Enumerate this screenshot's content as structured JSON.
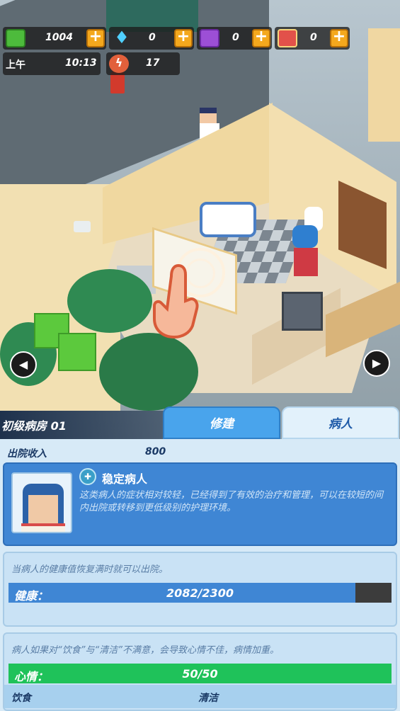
{
  "hud": {
    "cash": "1004",
    "gems": "0",
    "books": "0",
    "cards": "0",
    "period": "上午",
    "time": "10:13",
    "energy": "17"
  },
  "room": {
    "name": "初级病房 01",
    "tabs": [
      "修建",
      "病人"
    ]
  },
  "panel": {
    "income_label": "出院收入",
    "income_value": "800",
    "status": {
      "title": "稳定病人",
      "description": "这类病人的症状相对较轻，已经得到了有效的治疗和管理，可以在较短的间内出院或转移到更低级别的护理环境。"
    },
    "health": {
      "hint": "当病人的健康值恢复满时就可以出院。",
      "label": "健康：",
      "value": "2082/2300",
      "current": 2082,
      "max": 2300
    },
    "mood": {
      "hint": "病人如果对“饮食”与“清洁”不满意，会导致心情不佳，病情加重。",
      "label": "心情：",
      "value": "50/50",
      "current": 50,
      "max": 50,
      "factors": [
        "饮食",
        "清洁"
      ]
    }
  },
  "colors": {
    "health_fill": "#3f86d4",
    "mood_fill": "#1fc25a",
    "accent_orange": "#f4a81d"
  },
  "icons": [
    "cash-icon",
    "diamond-icon",
    "book-icon",
    "card-icon",
    "lightning-icon",
    "plus-icon",
    "chevron-left-icon",
    "chevron-right-icon",
    "tap-hand-icon",
    "status-icon"
  ]
}
